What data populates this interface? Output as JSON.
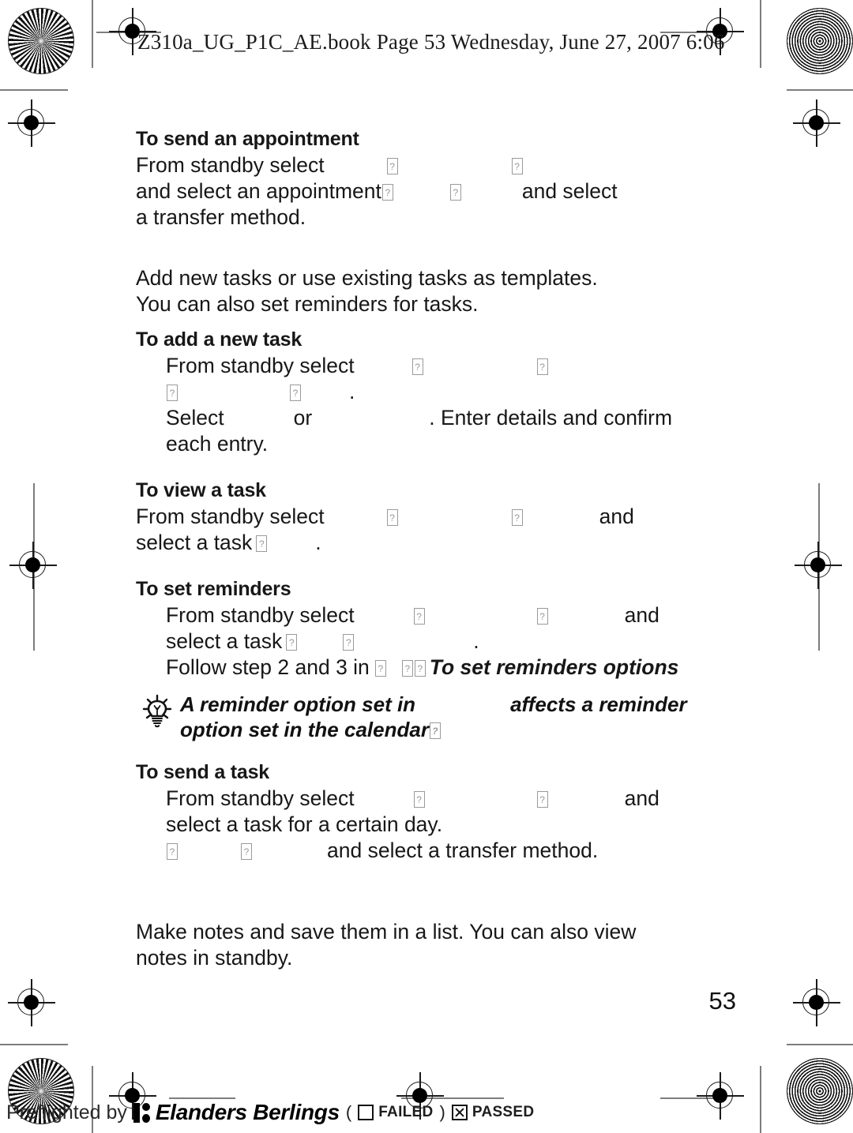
{
  "document": {
    "header_line": "Z310a_UG_P1C_AE.book  Page 53  Wednesday, June 27, 2007  6:06",
    "page_number": "53"
  },
  "sections": [
    {
      "heading": "To send an appointment",
      "lines": [
        "From standby select",
        "and select an appointment",
        "and select",
        "a transfer method."
      ]
    },
    {
      "heading": "To add a new task",
      "intro": [
        "Add new tasks or use existing tasks as templates.",
        "You can also set reminders for tasks."
      ],
      "lines": [
        "From standby select",
        "Select",
        "or",
        ". Enter details and confirm",
        "each entry."
      ]
    },
    {
      "heading": "To view a task",
      "lines": [
        "From standby select",
        "and",
        "select a task",
        "."
      ]
    },
    {
      "heading": "To set reminders",
      "lines": [
        "From standby select",
        "and",
        "select a task",
        ".",
        "Follow step 2 and 3 in",
        "To set reminders options"
      ]
    },
    {
      "heading": "To send a task",
      "lines": [
        "From standby select",
        "and",
        "select a task for a certain day.",
        "and select a transfer method."
      ]
    }
  ],
  "body": {
    "appointment_heading": "To send an appointment",
    "appointment_l1": "From standby select",
    "appointment_l2a": "and select an appointment",
    "appointment_l2b": "and select",
    "appointment_l3": "a transfer method.",
    "tasks_intro_1": "Add new tasks or use existing tasks as templates.",
    "tasks_intro_2": "You can also set reminders for tasks.",
    "addtask_heading": "To add a new task",
    "addtask_l1": "From standby select",
    "addtask_l2_dot": ".",
    "addtask_l3a": "Select",
    "addtask_l3b": "or",
    "addtask_l3c": ". Enter details and confirm",
    "addtask_l4": "each entry.",
    "viewtask_heading": "To view a task",
    "viewtask_l1a": "From standby select",
    "viewtask_l1b": "and",
    "viewtask_l2a": "select a task",
    "viewtask_l2b": ".",
    "reminders_heading": "To set reminders",
    "reminders_l1a": "From standby select",
    "reminders_l1b": "and",
    "reminders_l2a": "select a task",
    "reminders_l2b": ".",
    "reminders_l3a": "Follow step 2 and 3 in",
    "reminders_l3b": "To set reminders options",
    "sendtask_heading": "To send a task",
    "sendtask_l1a": "From standby select",
    "sendtask_l1b": "and",
    "sendtask_l2": "select a task for a certain day.",
    "sendtask_l3": "and select a transfer method.",
    "notes_1": "Make notes and save them in a list. You can also view",
    "notes_2": "notes in standby."
  },
  "tip": {
    "icon": "lightbulb-icon",
    "line1a": "A reminder option set in",
    "line1b": "affects a reminder",
    "line2": "option set in the calendar"
  },
  "preflight": {
    "label": "Preflighted by",
    "brand": "Elanders Berlings",
    "open_paren": "(",
    "failed_label": "FAILED",
    "close_paren": ")",
    "passed_label": "PASSED",
    "failed_checked": false,
    "passed_checked": true
  },
  "marks": {
    "registration_icon": "registration-target-icon",
    "sunburst_icon": "star-target-icon",
    "rings_icon": "concentric-rings-target-icon"
  },
  "colors": {
    "ink": "#111111",
    "tofu_border": "#9a9a9a",
    "crop_line": "#7d7d7d"
  }
}
